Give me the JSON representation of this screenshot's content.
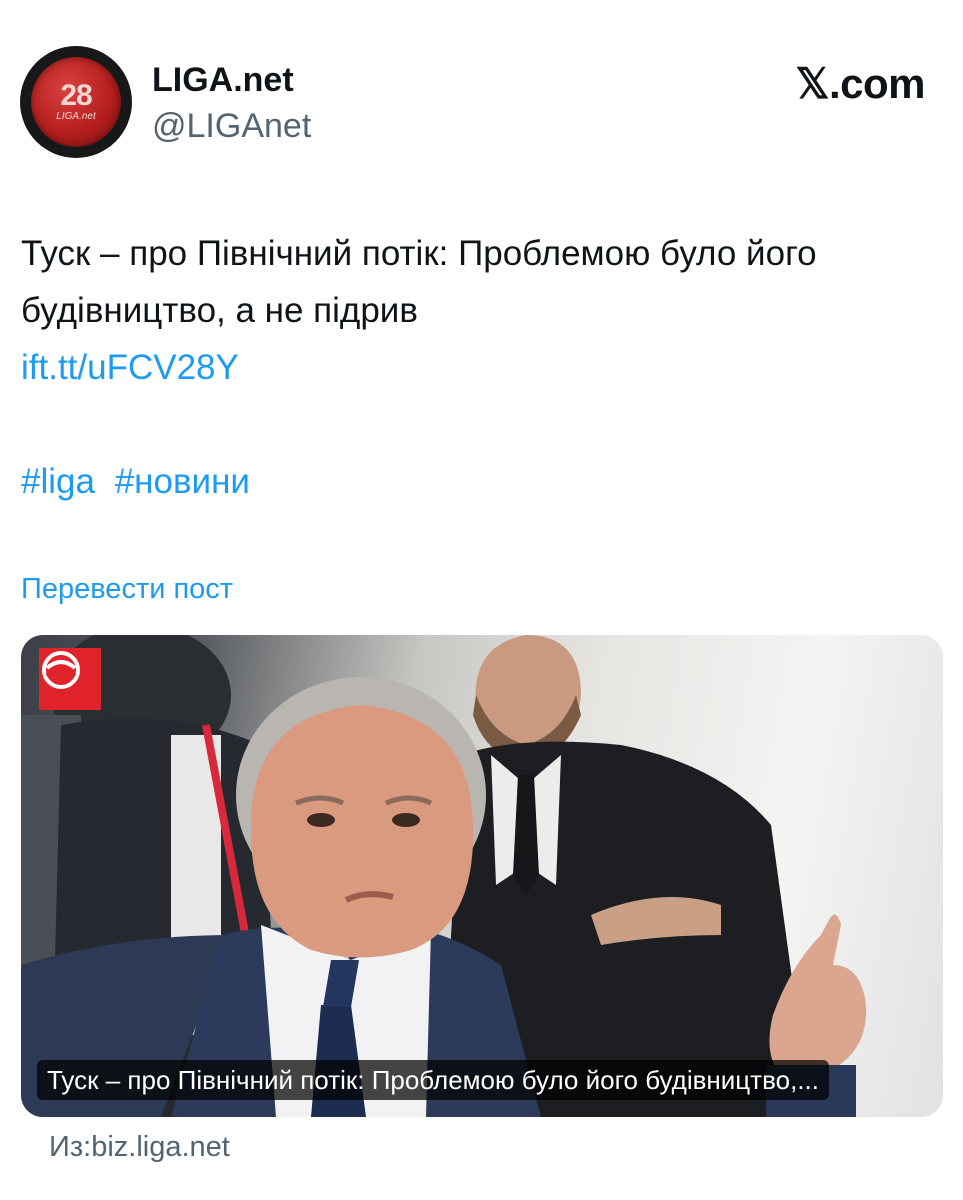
{
  "author": {
    "display_name": "LIGA.net",
    "handle": "@LIGAnet",
    "avatar_number": "28",
    "avatar_caption": "LIGA.net"
  },
  "brand": "𝕏.com",
  "tweet": {
    "text": "Туск – про Північний потік: Проблемою було його будівництво, а не підрив",
    "link": "ift.tt/uFCV28Y",
    "hashtags": [
      "#liga",
      "#новини"
    ],
    "translate_label": "Перевести пост"
  },
  "card": {
    "caption": "Туск – про Північний потік: Проблемою було його будівництво,...",
    "source": "Из:biz.liga.net"
  },
  "icons": [
    "liga-avatar",
    "x-logo",
    "liga-logo-icon"
  ]
}
